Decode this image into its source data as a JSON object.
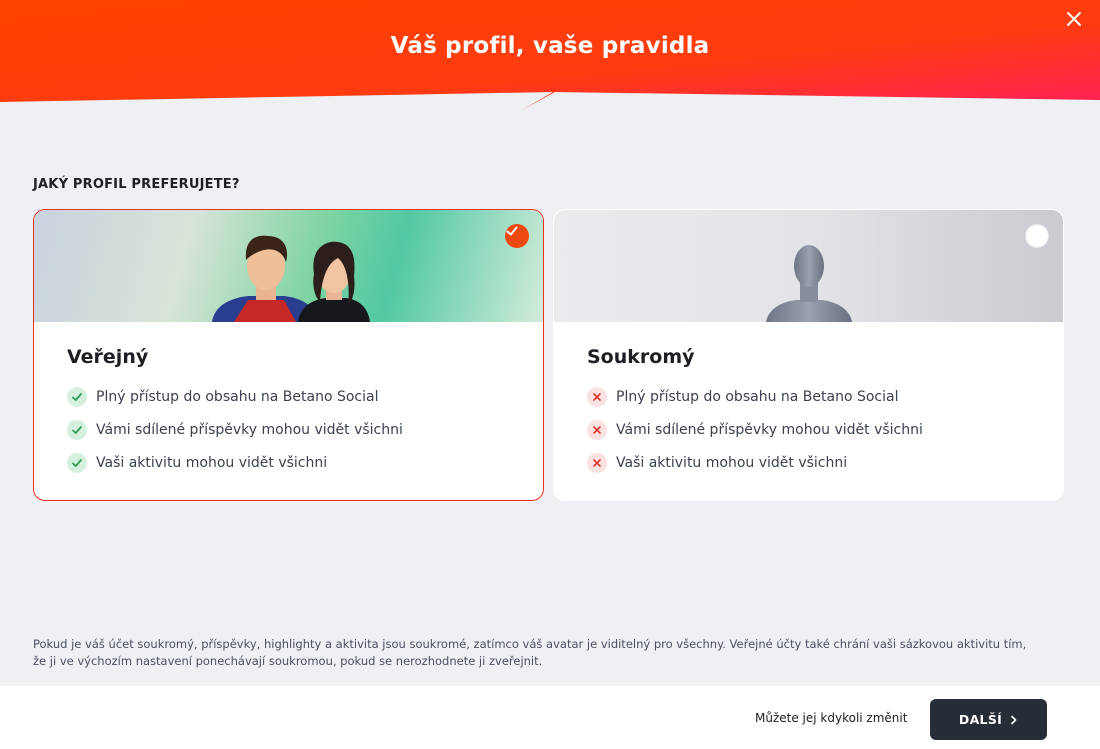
{
  "header": {
    "title": "Váš profil, vaše pravidla",
    "close_icon": "close-icon",
    "gradient_colors": [
      "#ff3b00",
      "#ff2a52"
    ]
  },
  "question": "JAKÝ PROFIL PREFERUJETE?",
  "options": [
    {
      "id": "public",
      "title": "Veřejný",
      "selected": true,
      "features": [
        {
          "text": "Plný přístup do obsahu na Betano Social",
          "icon": "check-icon"
        },
        {
          "text": "Vámi sdílené příspěvky mohou vidět všichni",
          "icon": "check-icon"
        },
        {
          "text": "Vaši aktivitu mohou vidět všichni",
          "icon": "check-icon"
        }
      ]
    },
    {
      "id": "private",
      "title": "Soukromý",
      "selected": false,
      "features": [
        {
          "text": "Plný přístup do obsahu na Betano Social",
          "icon": "cross-icon"
        },
        {
          "text": "Vámi sdílené příspěvky mohou vidět všichni",
          "icon": "cross-icon"
        },
        {
          "text": "Vaši aktivitu mohou vidět všichni",
          "icon": "cross-icon"
        }
      ]
    }
  ],
  "footer_note": "Pokud je váš účet soukromý, příspěvky, highlighty a aktivita jsou soukromé, zatímco váš avatar je viditelný pro všechny. Veřejné účty také chrání vaši sázkovou aktivitu tím, že ji ve výchozím nastavení ponechávají soukromou, pokud se nerozhodnete ji zveřejnit.",
  "bottom": {
    "change_note": "Můžete jej kdykoli změnit",
    "next_label": "DALŠÍ"
  },
  "colors": {
    "accent": "#ee4a12",
    "selected_border": "#e8311f",
    "button_bg": "#272d36",
    "check_bg": "#d6f0df",
    "cross_bg": "#fbe2e2"
  }
}
